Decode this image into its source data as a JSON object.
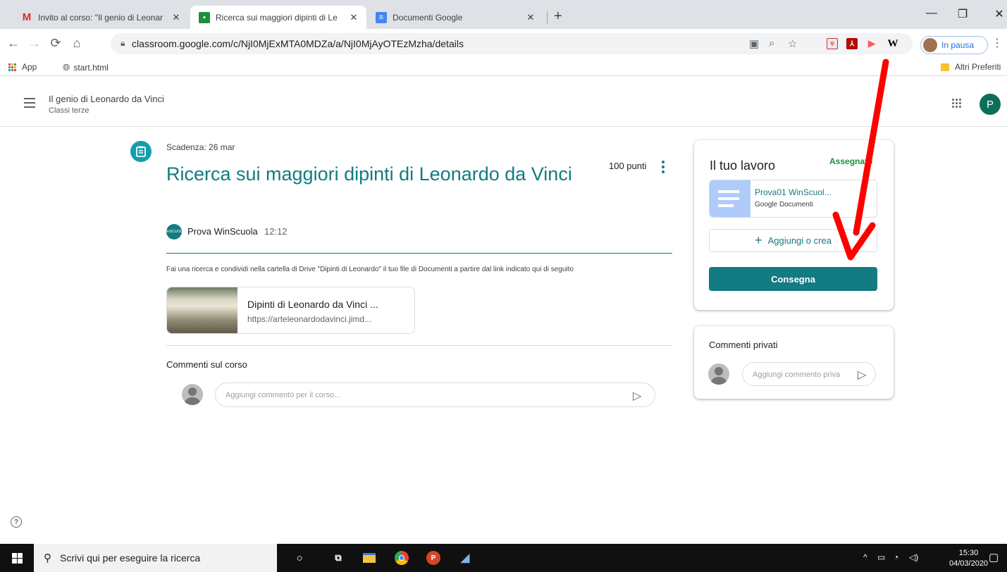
{
  "browser": {
    "tabs": [
      {
        "title": "Invito al corso: \"Il genio di Leonar",
        "favicon": "gmail-icon"
      },
      {
        "title": "Ricerca sui maggiori dipinti di Le",
        "favicon": "classroom-icon"
      },
      {
        "title": "Documenti Google",
        "favicon": "docs-icon"
      }
    ],
    "new_tab": "+",
    "url": "classroom.google.com/c/NjI0MjExMTA0MDZa/a/NjI0MjAyOTEzMzha/details",
    "profile_status": "In pausa",
    "bookmarks": {
      "apps": "App",
      "start": "start.html",
      "other": "Altri Preferiti"
    }
  },
  "classroom": {
    "course_title": "Il genio di Leonardo da Vinci",
    "course_section": "Classi terze",
    "user_initial": "P"
  },
  "assignment": {
    "due": "Scadenza: 26 mar",
    "title": "Ricerca sui maggiori dipinti di Leonardo da Vinci",
    "points": "100 punti",
    "author": "Prova WinScuola",
    "author_avatar_text": "WinSCUOLA",
    "time": "12:12",
    "instructions": "Fai una ricerca e condividi nella cartella di Drive \"Dipinti di Leonardo\" il tuo file di Documenti a partire dal link indicato qui di seguito",
    "link": {
      "title": "Dipinti di Leonardo da Vinci ...",
      "url": "https://arteleonardodavinci.jimd..."
    },
    "class_comments_label": "Commenti sul corso",
    "class_comment_placeholder": "Aggiungi commento per il corso..."
  },
  "your_work": {
    "title": "Il tuo lavoro",
    "status": "Assegnato",
    "file_name": "Prova01 WinScuol...",
    "file_type": "Google Documenti",
    "add_create": "Aggiungi o crea",
    "submit": "Consegna"
  },
  "private_comments": {
    "title": "Commenti privati",
    "placeholder": "Aggiungi commento priva"
  },
  "taskbar": {
    "search_placeholder": "Scrivi qui per eseguire la ricerca",
    "time": "15:30",
    "date": "04/03/2020"
  },
  "colors": {
    "accent": "#137b82",
    "annotation_arrow": "#ff0000",
    "status_green": "#1e8e3e"
  }
}
